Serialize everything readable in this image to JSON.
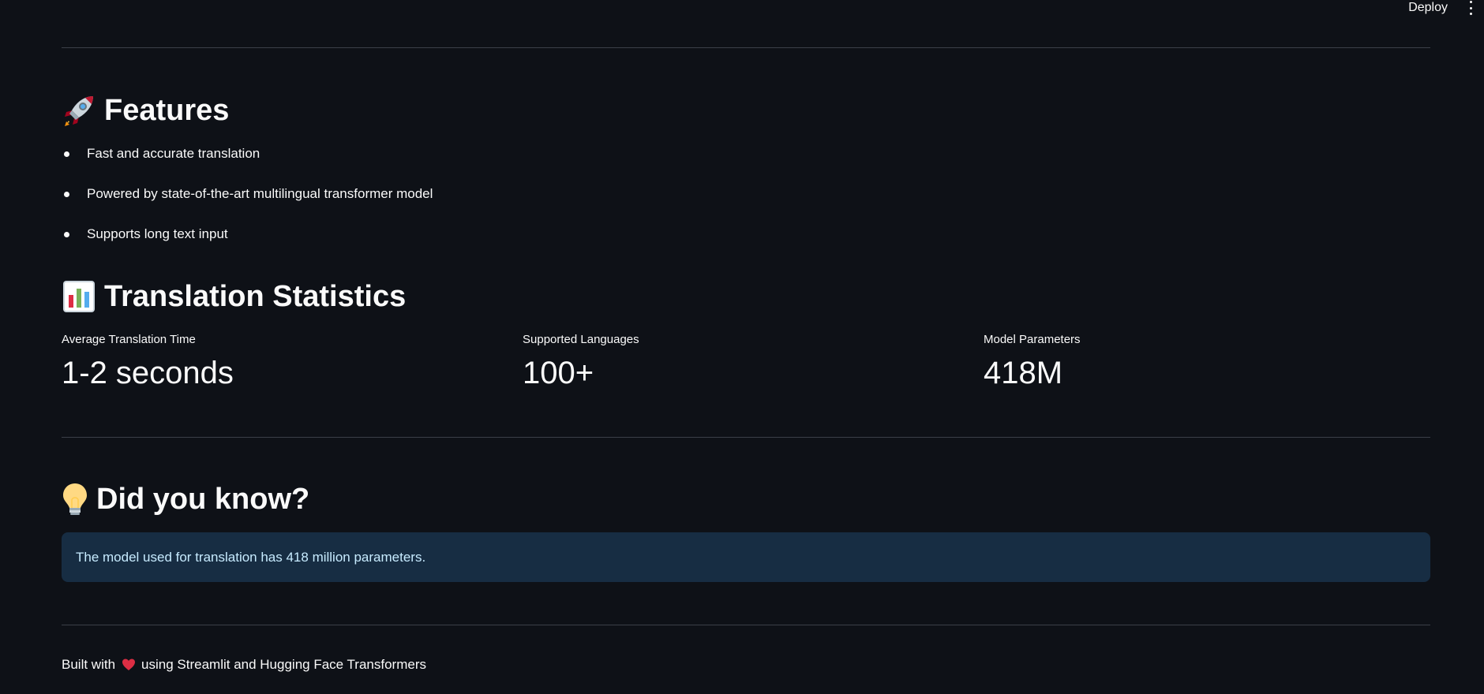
{
  "header": {
    "deploy_label": "Deploy",
    "menu_icon": "more-vertical-icon"
  },
  "features": {
    "icon": "rocket-icon",
    "title": "Features",
    "items": [
      "Fast and accurate translation",
      "Powered by state-of-the-art multilingual transformer model",
      "Supports long text input"
    ]
  },
  "statistics": {
    "icon": "bar-chart-icon",
    "title": "Translation Statistics",
    "metrics": [
      {
        "label": "Average Translation Time",
        "value": "1-2 seconds"
      },
      {
        "label": "Supported Languages",
        "value": "100+"
      },
      {
        "label": "Model Parameters",
        "value": "418M"
      }
    ]
  },
  "did_you_know": {
    "icon": "light-bulb-icon",
    "title": "Did you know?",
    "info": "The model used for translation has 418 million parameters."
  },
  "footer": {
    "prefix": "Built with",
    "icon": "heart-icon",
    "suffix": "using Streamlit and Hugging Face Transformers"
  },
  "colors": {
    "background": "#0e1117",
    "text": "#fafafa",
    "divider": "#3b3f48",
    "info_background": "#172d43",
    "info_text": "#c7ebff"
  }
}
